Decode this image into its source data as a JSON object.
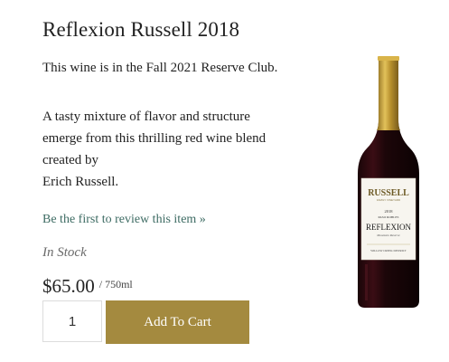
{
  "product": {
    "title": "Reflexion Russell 2018",
    "club_line": "This wine is in the Fall 2021 Reserve Club.",
    "description_lines": [
      "A tasty mixture of flavor and structure",
      "emerge from this thrilling red wine blend",
      "created by",
      "Erich Russell."
    ],
    "review_link": "Be the first to review this item »",
    "stock_status": "In Stock",
    "price": "$65.00",
    "unit": "/ 750ml"
  },
  "cart": {
    "quantity": "1",
    "add_label": "Add To Cart"
  },
  "bottle_label": {
    "brand": "RUSSELL",
    "brand_sub": "FAMILY VINEYARD",
    "year": "2018",
    "region": "PASO ROBLES",
    "name": "REFLEXION",
    "subtitle": "Mountain Reserve",
    "district": "WILLOW CREEK DISTRICT"
  },
  "colors": {
    "button": "#a48a3f",
    "link": "#3d6b63",
    "foil": "#c9a33a"
  }
}
